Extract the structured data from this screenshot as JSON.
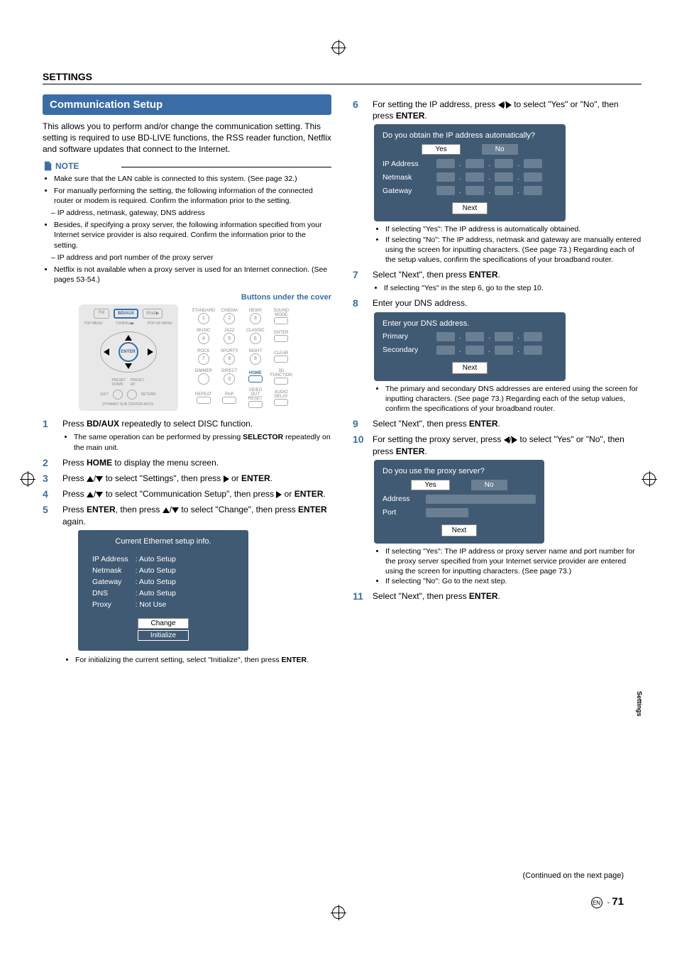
{
  "header": {
    "section": "SETTINGS"
  },
  "left": {
    "band": "Communication Setup",
    "intro": "This allows you to perform and/or change the communication setting. This setting is required to use BD-LIVE functions, the RSS reader function, Netflix and software updates that connect to the Internet.",
    "note_label": "NOTE",
    "notes": [
      "Make sure that the LAN cable is connected to this system. (See page 32.)",
      "For manually performing the setting, the following information of the connected router or modem is required. Confirm the information prior to the setting.",
      "– IP address, netmask, gateway, DNS address",
      "Besides, if specifying a proxy server, the following information specified from your Internet service provider is also required. Confirm the information prior to the setting.",
      "– IP address and port number of the proxy server",
      "Netflix is not available when a proxy server is used for an Internet connection. (See pages 53-54.)"
    ],
    "buttons_caption": "Buttons under the cover",
    "remote_btns": [
      "STANDARD",
      "CINEMA",
      "NEWS",
      "SOUND\nMODE",
      "MUSIC",
      "JAZZ",
      "CLASSIC",
      "ENTER",
      "ROCK",
      "SPORTS",
      "NIGHT",
      "CLEAR",
      "DIMMER",
      "DIRECT",
      "HOME",
      "3D\nFUNCTION",
      "REPEAT",
      "PinP",
      "VIDEO OUT\nRESET",
      "AUDIO\nDELAY"
    ],
    "step1_a": "Press ",
    "step1_b": "BD/AUX",
    "step1_c": " repeatedly to select DISC function.",
    "step1_sub": "The same operation can be performed by pressing SELECTOR repeatedly on the main unit.",
    "step2": [
      "Press ",
      "HOME",
      " to display the menu screen."
    ],
    "step3": [
      "Press ",
      " to select \"Settings\", then press ",
      " or ",
      "ENTER",
      "."
    ],
    "step4": [
      "Press ",
      " to select \"Communication Setup\", then press ",
      " or ",
      "ENTER",
      "."
    ],
    "step5": [
      "Press ",
      "ENTER",
      ", then press ",
      " to select \"Change\", then press ",
      "ENTER",
      " again."
    ],
    "ethernet": {
      "title": "Current Ethernet setup info.",
      "rows": [
        [
          "IP Address",
          ": Auto Setup"
        ],
        [
          "Netmask",
          ": Auto Setup"
        ],
        [
          "Gateway",
          ": Auto Setup"
        ],
        [
          "DNS",
          ": Auto Setup"
        ],
        [
          "Proxy",
          ": Not Use"
        ]
      ],
      "change": "Change",
      "initialize": "Initialize"
    },
    "step5_sub": "For initializing the current setting, select \"Initialize\", then press ENTER."
  },
  "right": {
    "step6": [
      "For setting the IP address, press ",
      " to select \"Yes\" or \"No\", then press ",
      "ENTER",
      "."
    ],
    "osd1": {
      "q": "Do you obtain the IP address automatically?",
      "yes": "Yes",
      "no": "No",
      "rows": [
        "IP Address",
        "Netmask",
        "Gateway"
      ],
      "next": "Next"
    },
    "step6_sub": [
      "If selecting \"Yes\": The IP address is automatically obtained.",
      "If selecting \"No\": The IP address, netmask and gateway are manually entered using the screen for inputting characters. (See page 73.) Regarding each of the setup values, confirm the specifications of your broadband router."
    ],
    "step7": [
      "Select \"Next\", then press ",
      "ENTER",
      "."
    ],
    "step7_sub": "If selecting \"Yes\" in the step 6, go to the step 10.",
    "step8": "Enter your DNS address.",
    "osd2": {
      "q": "Enter your DNS address.",
      "rows": [
        "Primary",
        "Secondary"
      ],
      "next": "Next"
    },
    "step8_sub": "The primary and secondary DNS addresses are entered using the screen for inputting characters. (See page 73.) Regarding each of the setup values, confirm the specifications of your broadband router.",
    "step9": [
      "Select \"Next\", then press ",
      "ENTER",
      "."
    ],
    "step10": [
      "For setting the proxy server, press ",
      " to select \"Yes\" or \"No\", then press ",
      "ENTER",
      "."
    ],
    "osd3": {
      "q": "Do you use the proxy server?",
      "yes": "Yes",
      "no": "No",
      "rows": [
        "Address",
        "Port"
      ],
      "next": "Next"
    },
    "step10_sub": [
      "If selecting \"Yes\": The IP address or proxy server name and port number for the proxy server specified from your Internet service provider are entered using the screen for inputting characters. (See page 73.)",
      "If selecting \"No\": Go to the next step."
    ],
    "step11": [
      "Select \"Next\", then press ",
      "ENTER",
      "."
    ]
  },
  "footer": {
    "side_tab": "Settings",
    "continued": "(Continued on the next page)",
    "en": "EN",
    "dash": " - ",
    "page": "71"
  }
}
